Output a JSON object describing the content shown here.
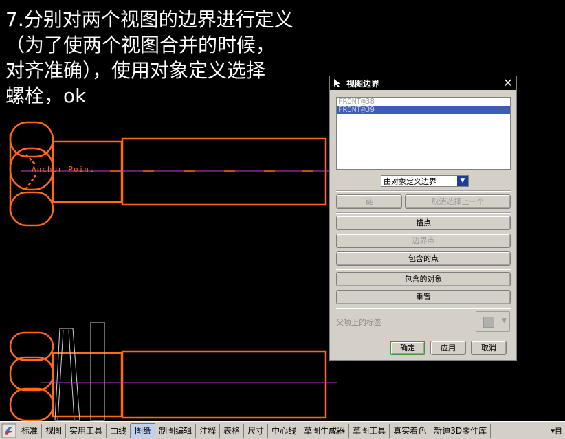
{
  "caption": "7.分别对两个视图的边界进行定义\n（为了使两个视图合并的时候，\n对齐准确），使用对象定义选择\n螺栓，ok",
  "cad": {
    "anchor_label": "Anchor Point"
  },
  "dialog": {
    "title": "视图边界",
    "close_glyph": "✕",
    "list_items": [
      "FRONT@38",
      "FRONT@39"
    ],
    "selected_item": "FRONT@39",
    "boundary_mode": "由对象定义边界",
    "chain_button": "链",
    "cancel_last_button": "取消选择上一个",
    "anchor_button": "锚点",
    "boundary_point_button": "边界点",
    "included_points_button": "包含的点",
    "included_objects_button": "包含的对象",
    "reset_button": "重置",
    "parent_label": "父项上的标签",
    "ok_button": "确定",
    "apply_button": "应用",
    "cancel_button": "取消"
  },
  "toolbar": {
    "tabs": [
      "标准",
      "视图",
      "实用工具",
      "曲线",
      "图纸",
      "制图编辑",
      "注释",
      "表格",
      "尺寸",
      "中心线",
      "草图生成器",
      "草图工具",
      "真实着色",
      "新迪3D零件库"
    ],
    "active_tab": "图纸",
    "end_glyph": "▾目"
  },
  "colors": {
    "cad_orange": "#ff6a1a",
    "center_line": "#c23fd0",
    "ok_border": "#3a9a3a"
  }
}
